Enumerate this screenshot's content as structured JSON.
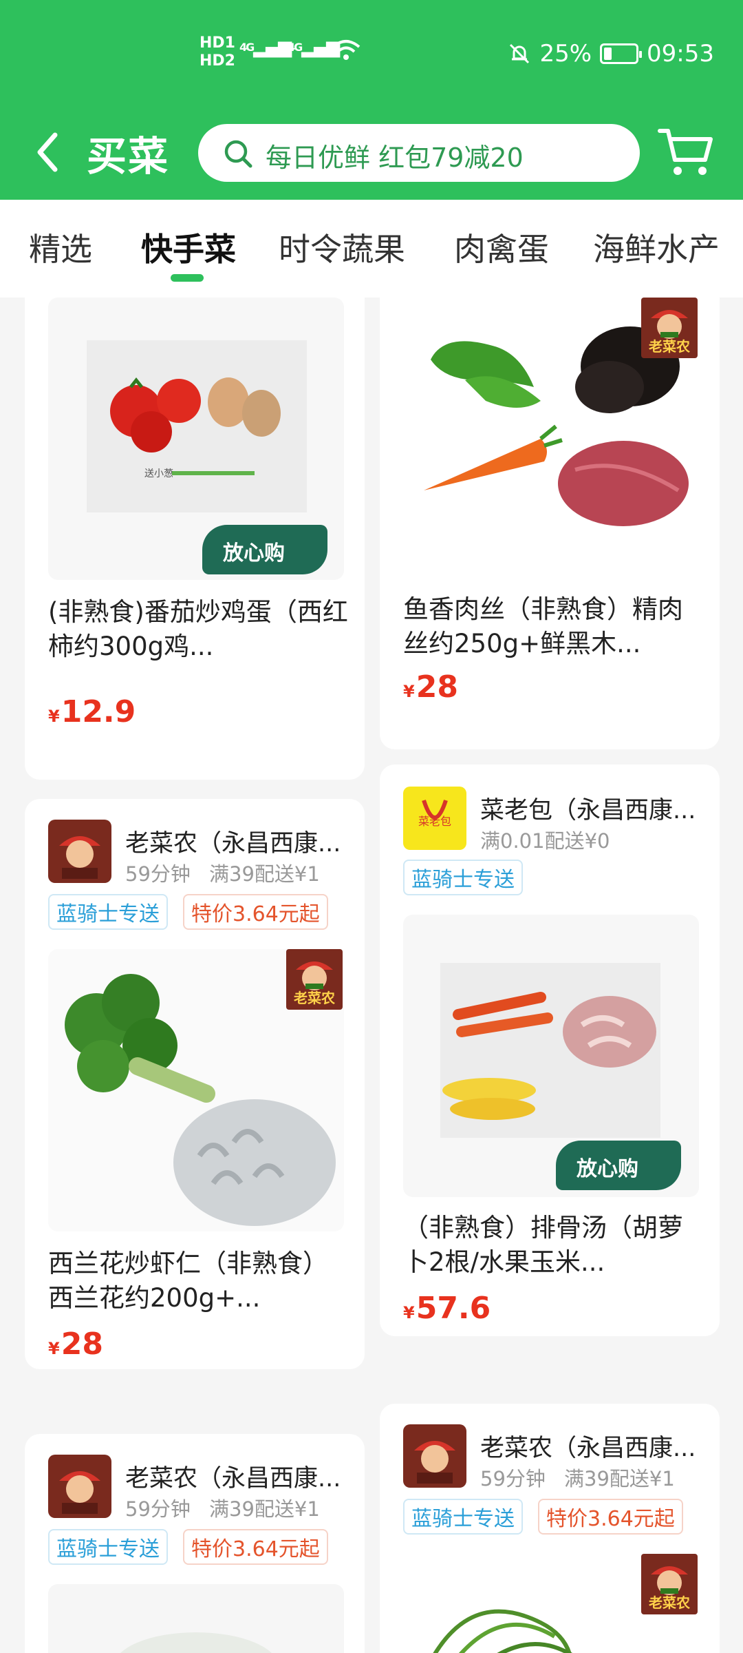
{
  "status_bar": {
    "sim1": "HD1",
    "sim2": "HD2",
    "net1": "4G",
    "net2": "4G",
    "battery": "25%",
    "battery_level": 0.25,
    "time": "09:53"
  },
  "header": {
    "title": "买菜",
    "search_placeholder": "每日优鲜 红包79减20"
  },
  "tabs": [
    "精选",
    "快手菜",
    "时令蔬果",
    "肉禽蛋",
    "海鲜水产"
  ],
  "active_tab": 1,
  "products": [
    {
      "name": "(非熟食)番茄炒鸡蛋（西红柿约300g鸡...",
      "yen": "¥",
      "price": "12.9",
      "badge": "放心购",
      "img_caption": "送小葱"
    },
    {
      "name": "鱼香肉丝（非熟食）精肉丝约250g+鲜黑木...",
      "yen": "¥",
      "price": "28",
      "brand": "老菜农"
    },
    {
      "store": "老菜农（永昌西康...",
      "time": "59分钟",
      "min_order": "满39配送¥1",
      "tags": [
        "蓝骑士专送",
        "特价3.64元起"
      ],
      "name": "西兰花炒虾仁（非熟食）西兰花约200g+...",
      "yen": "¥",
      "price": "28",
      "brand": "老菜农"
    },
    {
      "store": "菜老包（永昌西康...",
      "min_order": "满0.01配送¥0",
      "tags": [
        "蓝骑士专送"
      ],
      "name": "（非熟食）排骨汤（胡萝卜2根/水果玉米...",
      "yen": "¥",
      "price": "57.6",
      "badge": "放心购",
      "logo_text": "菜老包"
    },
    {
      "store": "老菜农（永昌西康...",
      "time": "59分钟",
      "min_order": "满39配送¥1",
      "tags": [
        "蓝骑士专送"
      ]
    },
    {
      "store": "老菜农（永昌西康...",
      "time": "59分钟",
      "min_order": "满39配送¥1",
      "tags": [
        "蓝骑士专送",
        "特价3.64元起"
      ],
      "brand": "老菜农"
    }
  ],
  "colors": {
    "brand_green": "#2ec05c",
    "price_red": "#e8321e",
    "tag_blue": "#2b9fd8",
    "tag_red": "#e4542c"
  }
}
